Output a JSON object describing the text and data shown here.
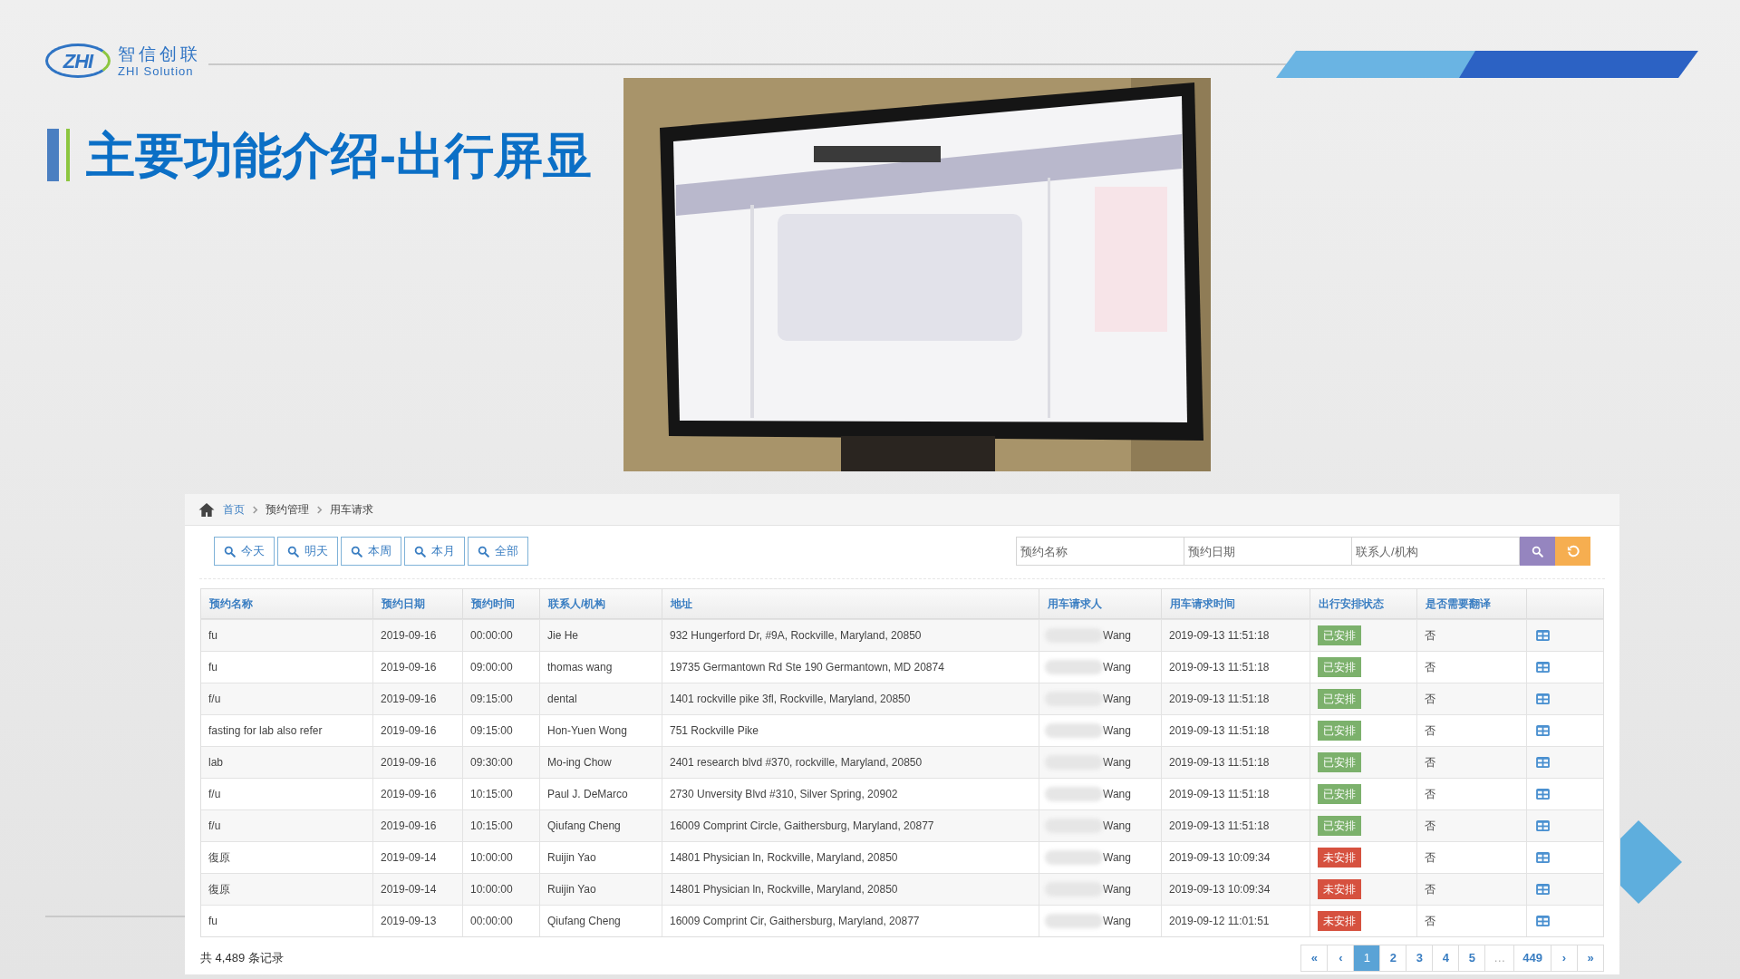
{
  "logo": {
    "mark": "ZHI",
    "name": "智信创联",
    "tagline": "ZHI Solution"
  },
  "title": "主要功能介绍-出行屏显",
  "app": {
    "breadcrumb": [
      {
        "label": "首页",
        "kind": "link"
      },
      {
        "label": "预约管理",
        "kind": "text"
      },
      {
        "label": "用车请求",
        "kind": "text"
      }
    ],
    "quick_filters": [
      "今天",
      "明天",
      "本周",
      "本月",
      "全部"
    ],
    "search_fields": [
      {
        "placeholder": "预约名称"
      },
      {
        "placeholder": "预约日期"
      },
      {
        "placeholder": "联系人/机构"
      }
    ],
    "columns": [
      "预约名称",
      "预约日期",
      "预约时间",
      "联系人/机构",
      "地址",
      "用车请求人",
      "用车请求时间",
      "出行安排状态",
      "是否需要翻译"
    ],
    "rows": [
      {
        "name": "fu",
        "date": "2019-09-16",
        "time": "00:00:00",
        "contact": "Jie He",
        "address": "932 Hungerford Dr, #9A, Rockville, Maryland, 20850",
        "requester": "Wang",
        "requested_at": "2019-09-13 11:51:18",
        "status": {
          "label": "已安排",
          "color": "#7cb16c"
        },
        "translation": "否"
      },
      {
        "name": "fu",
        "date": "2019-09-16",
        "time": "09:00:00",
        "contact": "thomas wang",
        "address": "19735 Germantown Rd Ste 190 Germantown, MD 20874",
        "requester": "Wang",
        "requested_at": "2019-09-13 11:51:18",
        "status": {
          "label": "已安排",
          "color": "#7cb16c"
        },
        "translation": "否"
      },
      {
        "name": "f/u",
        "date": "2019-09-16",
        "time": "09:15:00",
        "contact": "dental",
        "address": "1401 rockville pike 3fl, Rockville, Maryland, 20850",
        "requester": "Wang",
        "requested_at": "2019-09-13 11:51:18",
        "status": {
          "label": "已安排",
          "color": "#7cb16c"
        },
        "translation": "否"
      },
      {
        "name": "fasting for lab also refer",
        "date": "2019-09-16",
        "time": "09:15:00",
        "contact": "Hon-Yuen Wong",
        "address": "751 Rockville Pike",
        "requester": "Wang",
        "requested_at": "2019-09-13 11:51:18",
        "status": {
          "label": "已安排",
          "color": "#7cb16c"
        },
        "translation": "否"
      },
      {
        "name": "lab",
        "date": "2019-09-16",
        "time": "09:30:00",
        "contact": "Mo-ing Chow",
        "address": "2401 research blvd #370, rockville, Maryland, 20850",
        "requester": "Wang",
        "requested_at": "2019-09-13 11:51:18",
        "status": {
          "label": "已安排",
          "color": "#7cb16c"
        },
        "translation": "否"
      },
      {
        "name": "f/u",
        "date": "2019-09-16",
        "time": "10:15:00",
        "contact": "Paul J. DeMarco",
        "address": "2730 Unversity Blvd #310, Silver Spring, 20902",
        "requester": "Wang",
        "requested_at": "2019-09-13 11:51:18",
        "status": {
          "label": "已安排",
          "color": "#7cb16c"
        },
        "translation": "否"
      },
      {
        "name": "f/u",
        "date": "2019-09-16",
        "time": "10:15:00",
        "contact": "Qiufang Cheng",
        "address": "16009 Comprint Circle, Gaithersburg, Maryland, 20877",
        "requester": "Wang",
        "requested_at": "2019-09-13 11:51:18",
        "status": {
          "label": "已安排",
          "color": "#7cb16c"
        },
        "translation": "否"
      },
      {
        "name": "復原",
        "date": "2019-09-14",
        "time": "10:00:00",
        "contact": "Ruijin Yao",
        "address": "14801 Physician ln, Rockville, Maryland, 20850",
        "requester": "Wang",
        "requested_at": "2019-09-13 10:09:34",
        "status": {
          "label": "未安排",
          "color": "#d6513f"
        },
        "translation": "否"
      },
      {
        "name": "復原",
        "date": "2019-09-14",
        "time": "10:00:00",
        "contact": "Ruijin Yao",
        "address": "14801 Physician ln, Rockville, Maryland, 20850",
        "requester": "Wang",
        "requested_at": "2019-09-13 10:09:34",
        "status": {
          "label": "未安排",
          "color": "#d6513f"
        },
        "translation": "否"
      },
      {
        "name": "fu",
        "date": "2019-09-13",
        "time": "00:00:00",
        "contact": "Qiufang Cheng",
        "address": "16009 Comprint Cir, Gaithersburg, Maryland, 20877",
        "requester": "Wang",
        "requested_at": "2019-09-12 11:01:51",
        "status": {
          "label": "未安排",
          "color": "#d6513f"
        },
        "translation": "否"
      }
    ],
    "total": "共 4,489 条记录",
    "pagination": [
      {
        "label": "«",
        "selected": false,
        "disabled": false
      },
      {
        "label": "‹",
        "selected": false,
        "disabled": false
      },
      {
        "label": "1",
        "selected": true,
        "disabled": false
      },
      {
        "label": "2",
        "selected": false,
        "disabled": false
      },
      {
        "label": "3",
        "selected": false,
        "disabled": false
      },
      {
        "label": "4",
        "selected": false,
        "disabled": false
      },
      {
        "label": "5",
        "selected": false,
        "disabled": false
      },
      {
        "label": "…",
        "selected": false,
        "disabled": true
      },
      {
        "label": "449",
        "selected": false,
        "disabled": false
      },
      {
        "label": "›",
        "selected": false,
        "disabled": false
      },
      {
        "label": "»",
        "selected": false,
        "disabled": false
      }
    ]
  }
}
